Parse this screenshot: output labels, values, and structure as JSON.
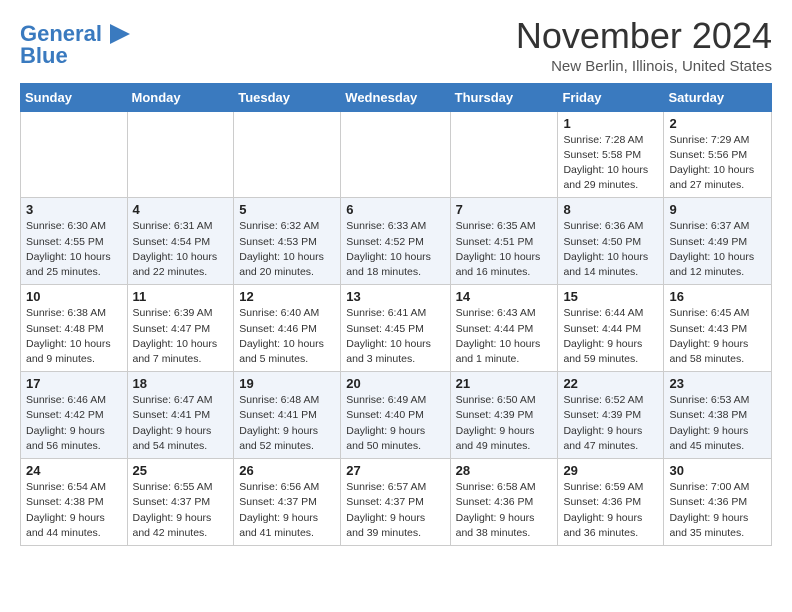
{
  "logo": {
    "line1": "General",
    "line2": "Blue"
  },
  "title": "November 2024",
  "location": "New Berlin, Illinois, United States",
  "weekdays": [
    "Sunday",
    "Monday",
    "Tuesday",
    "Wednesday",
    "Thursday",
    "Friday",
    "Saturday"
  ],
  "rows": [
    [
      {
        "day": "",
        "info": ""
      },
      {
        "day": "",
        "info": ""
      },
      {
        "day": "",
        "info": ""
      },
      {
        "day": "",
        "info": ""
      },
      {
        "day": "",
        "info": ""
      },
      {
        "day": "1",
        "info": "Sunrise: 7:28 AM\nSunset: 5:58 PM\nDaylight: 10 hours\nand 29 minutes."
      },
      {
        "day": "2",
        "info": "Sunrise: 7:29 AM\nSunset: 5:56 PM\nDaylight: 10 hours\nand 27 minutes."
      }
    ],
    [
      {
        "day": "3",
        "info": "Sunrise: 6:30 AM\nSunset: 4:55 PM\nDaylight: 10 hours\nand 25 minutes."
      },
      {
        "day": "4",
        "info": "Sunrise: 6:31 AM\nSunset: 4:54 PM\nDaylight: 10 hours\nand 22 minutes."
      },
      {
        "day": "5",
        "info": "Sunrise: 6:32 AM\nSunset: 4:53 PM\nDaylight: 10 hours\nand 20 minutes."
      },
      {
        "day": "6",
        "info": "Sunrise: 6:33 AM\nSunset: 4:52 PM\nDaylight: 10 hours\nand 18 minutes."
      },
      {
        "day": "7",
        "info": "Sunrise: 6:35 AM\nSunset: 4:51 PM\nDaylight: 10 hours\nand 16 minutes."
      },
      {
        "day": "8",
        "info": "Sunrise: 6:36 AM\nSunset: 4:50 PM\nDaylight: 10 hours\nand 14 minutes."
      },
      {
        "day": "9",
        "info": "Sunrise: 6:37 AM\nSunset: 4:49 PM\nDaylight: 10 hours\nand 12 minutes."
      }
    ],
    [
      {
        "day": "10",
        "info": "Sunrise: 6:38 AM\nSunset: 4:48 PM\nDaylight: 10 hours\nand 9 minutes."
      },
      {
        "day": "11",
        "info": "Sunrise: 6:39 AM\nSunset: 4:47 PM\nDaylight: 10 hours\nand 7 minutes."
      },
      {
        "day": "12",
        "info": "Sunrise: 6:40 AM\nSunset: 4:46 PM\nDaylight: 10 hours\nand 5 minutes."
      },
      {
        "day": "13",
        "info": "Sunrise: 6:41 AM\nSunset: 4:45 PM\nDaylight: 10 hours\nand 3 minutes."
      },
      {
        "day": "14",
        "info": "Sunrise: 6:43 AM\nSunset: 4:44 PM\nDaylight: 10 hours\nand 1 minute."
      },
      {
        "day": "15",
        "info": "Sunrise: 6:44 AM\nSunset: 4:44 PM\nDaylight: 9 hours\nand 59 minutes."
      },
      {
        "day": "16",
        "info": "Sunrise: 6:45 AM\nSunset: 4:43 PM\nDaylight: 9 hours\nand 58 minutes."
      }
    ],
    [
      {
        "day": "17",
        "info": "Sunrise: 6:46 AM\nSunset: 4:42 PM\nDaylight: 9 hours\nand 56 minutes."
      },
      {
        "day": "18",
        "info": "Sunrise: 6:47 AM\nSunset: 4:41 PM\nDaylight: 9 hours\nand 54 minutes."
      },
      {
        "day": "19",
        "info": "Sunrise: 6:48 AM\nSunset: 4:41 PM\nDaylight: 9 hours\nand 52 minutes."
      },
      {
        "day": "20",
        "info": "Sunrise: 6:49 AM\nSunset: 4:40 PM\nDaylight: 9 hours\nand 50 minutes."
      },
      {
        "day": "21",
        "info": "Sunrise: 6:50 AM\nSunset: 4:39 PM\nDaylight: 9 hours\nand 49 minutes."
      },
      {
        "day": "22",
        "info": "Sunrise: 6:52 AM\nSunset: 4:39 PM\nDaylight: 9 hours\nand 47 minutes."
      },
      {
        "day": "23",
        "info": "Sunrise: 6:53 AM\nSunset: 4:38 PM\nDaylight: 9 hours\nand 45 minutes."
      }
    ],
    [
      {
        "day": "24",
        "info": "Sunrise: 6:54 AM\nSunset: 4:38 PM\nDaylight: 9 hours\nand 44 minutes."
      },
      {
        "day": "25",
        "info": "Sunrise: 6:55 AM\nSunset: 4:37 PM\nDaylight: 9 hours\nand 42 minutes."
      },
      {
        "day": "26",
        "info": "Sunrise: 6:56 AM\nSunset: 4:37 PM\nDaylight: 9 hours\nand 41 minutes."
      },
      {
        "day": "27",
        "info": "Sunrise: 6:57 AM\nSunset: 4:37 PM\nDaylight: 9 hours\nand 39 minutes."
      },
      {
        "day": "28",
        "info": "Sunrise: 6:58 AM\nSunset: 4:36 PM\nDaylight: 9 hours\nand 38 minutes."
      },
      {
        "day": "29",
        "info": "Sunrise: 6:59 AM\nSunset: 4:36 PM\nDaylight: 9 hours\nand 36 minutes."
      },
      {
        "day": "30",
        "info": "Sunrise: 7:00 AM\nSunset: 4:36 PM\nDaylight: 9 hours\nand 35 minutes."
      }
    ]
  ]
}
